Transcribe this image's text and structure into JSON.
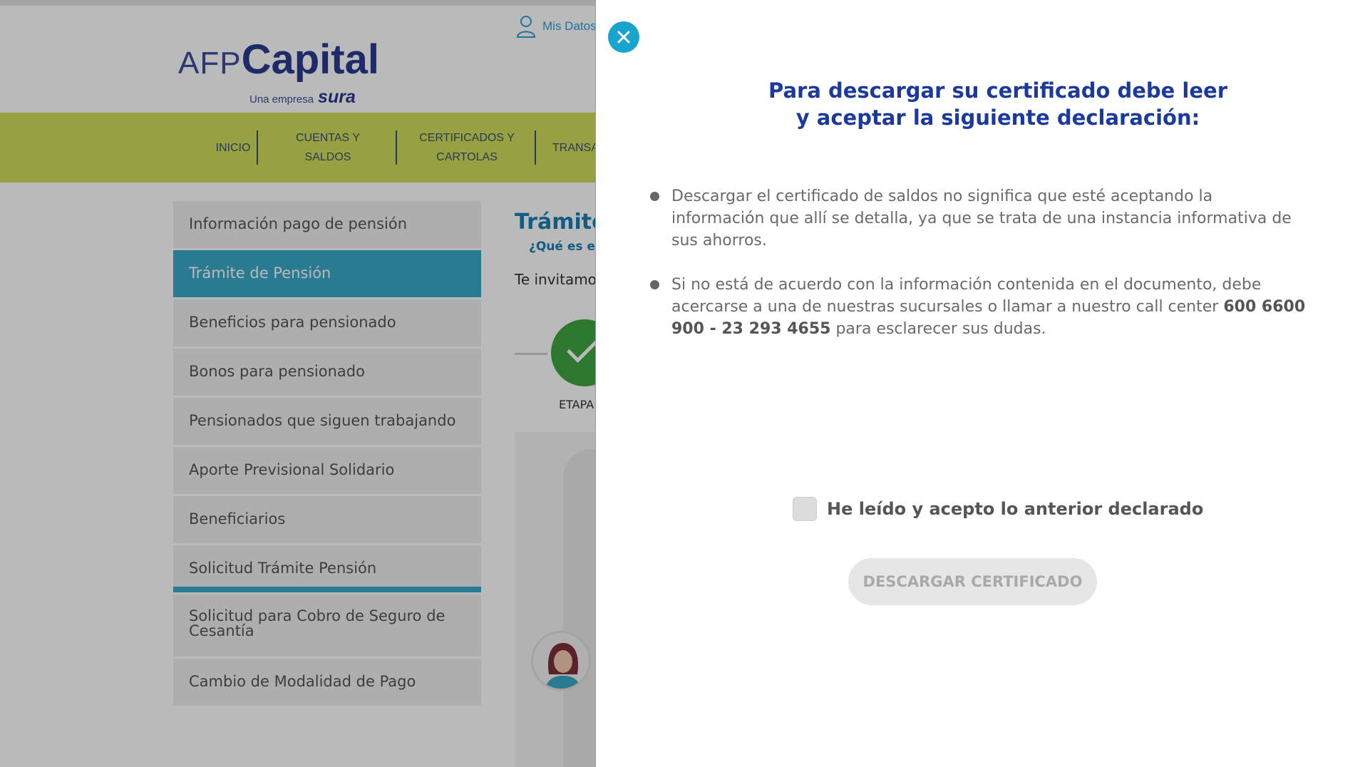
{
  "header": {
    "mis_datos": "Mis Datos",
    "logo_afp": "AFP",
    "logo_capital": "Capital",
    "logo_una_empresa": "Una empresa",
    "logo_sura": "sura"
  },
  "nav": {
    "items": [
      {
        "line1": "INICIO",
        "line2": ""
      },
      {
        "line1": "CUENTAS Y",
        "line2": "SALDOS"
      },
      {
        "line1": "CERTIFICADOS Y",
        "line2": "CARTOLAS"
      },
      {
        "line1": "TRANSA",
        "line2": ""
      }
    ]
  },
  "sidebar": {
    "items": [
      {
        "label": "Información pago de pensión"
      },
      {
        "label": "Trámite de Pensión"
      },
      {
        "label": "Beneficios para pensionado"
      },
      {
        "label": "Bonos para pensionado"
      },
      {
        "label": "Pensionados que siguen trabajando"
      },
      {
        "label": "Aporte Previsional Solidario"
      },
      {
        "label": "Beneficiarios"
      },
      {
        "label": "Solicitud Trámite Pensión"
      },
      {
        "label": "Solicitud para Cobro de Seguro de Cesantía"
      },
      {
        "label": "Cambio de Modalidad de Pago"
      }
    ]
  },
  "main": {
    "title": "Trámite",
    "question": "¿Qué es el",
    "intro": "Te invitamos",
    "step_label": "ETAPA"
  },
  "modal": {
    "title_line1": "Para descargar su certificado debe leer",
    "title_line2": "y aceptar la siguiente declaración:",
    "item1": "Descargar el certificado de saldos no significa que esté aceptando la información que allí se detalla, ya que se trata de una instancia informativa de sus ahorros.",
    "item2_before": "Si no está de acuerdo con la información contenida en el documento, debe acercarse a una de nuestras sucursales o llamar a nuestro call center ",
    "item2_phone1": "600 6600",
    "item2_phone2": "900 - 23 293 4655",
    "item2_after": " para esclarecer sus dudas.",
    "accept_label": "He leído y acepto lo anterior declarado",
    "download_label": "DESCARGAR CERTIFICADO",
    "colors": {
      "title": "#1c3a9c",
      "close_button": "#19a3cf",
      "button_disabled": "#e6e6e6"
    }
  }
}
